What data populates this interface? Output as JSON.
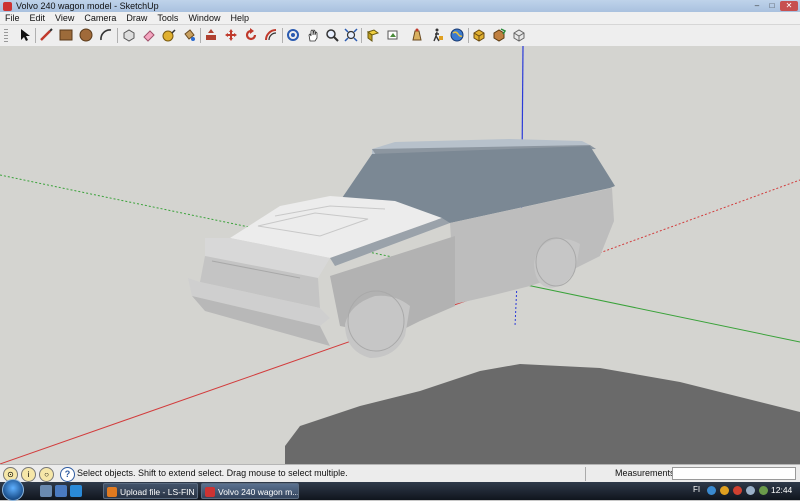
{
  "window": {
    "title": "Volvo 240 wagon model - SketchUp",
    "controls": [
      "–",
      "□",
      "✕"
    ]
  },
  "menu": [
    "File",
    "Edit",
    "View",
    "Camera",
    "Draw",
    "Tools",
    "Window",
    "Help"
  ],
  "toolbar": {
    "tools": [
      {
        "name": "select-tool",
        "icon": "arrow-cursor-icon"
      },
      {
        "name": "line-tool",
        "icon": "pencil-icon"
      },
      {
        "name": "rectangle-tool",
        "icon": "rectangle-icon"
      },
      {
        "name": "circle-tool",
        "icon": "circle-icon"
      },
      {
        "name": "arc-tool",
        "icon": "arc-icon"
      },
      {
        "name": "make-component-tool",
        "icon": "component-icon"
      },
      {
        "name": "eraser-tool",
        "icon": "eraser-icon"
      },
      {
        "name": "tape-measure-tool",
        "icon": "tape-measure-icon"
      },
      {
        "name": "paint-bucket-tool",
        "icon": "paint-bucket-icon"
      },
      {
        "name": "push-pull-tool",
        "icon": "push-pull-icon"
      },
      {
        "name": "move-tool",
        "icon": "move-icon"
      },
      {
        "name": "rotate-tool",
        "icon": "rotate-icon"
      },
      {
        "name": "offset-tool",
        "icon": "offset-icon"
      },
      {
        "name": "orbit-tool",
        "icon": "orbit-icon"
      },
      {
        "name": "pan-tool",
        "icon": "hand-icon"
      },
      {
        "name": "zoom-tool",
        "icon": "magnifier-icon"
      },
      {
        "name": "zoom-extents-tool",
        "icon": "zoom-extents-icon"
      },
      {
        "name": "previous-view-tool",
        "icon": "previous-view-icon"
      },
      {
        "name": "next-view-tool",
        "icon": "next-view-icon"
      },
      {
        "name": "position-camera-tool",
        "icon": "position-camera-icon"
      },
      {
        "name": "get-models-tool",
        "icon": "globe-icon"
      },
      {
        "name": "share-model-tool",
        "icon": "share-model-icon"
      },
      {
        "name": "warehouse-tool",
        "icon": "warehouse-icon"
      }
    ]
  },
  "status": {
    "hint": "Select objects. Shift to extend select. Drag mouse to select multiple.",
    "measurements_label": "Measurements",
    "measurements_value": ""
  },
  "taskbar": {
    "buttons": [
      {
        "label": "Upload file - LS-FIN ...",
        "active": false
      },
      {
        "label": "Volvo 240 wagon m...",
        "active": true
      }
    ],
    "language": "FI",
    "clock": "12:44"
  },
  "colors": {
    "axis_red": "#d23c3c",
    "axis_green": "#3aa23a",
    "axis_blue": "#2a3ad8",
    "sky": "#d4d4d0",
    "shadow": "#6a6a6a"
  }
}
